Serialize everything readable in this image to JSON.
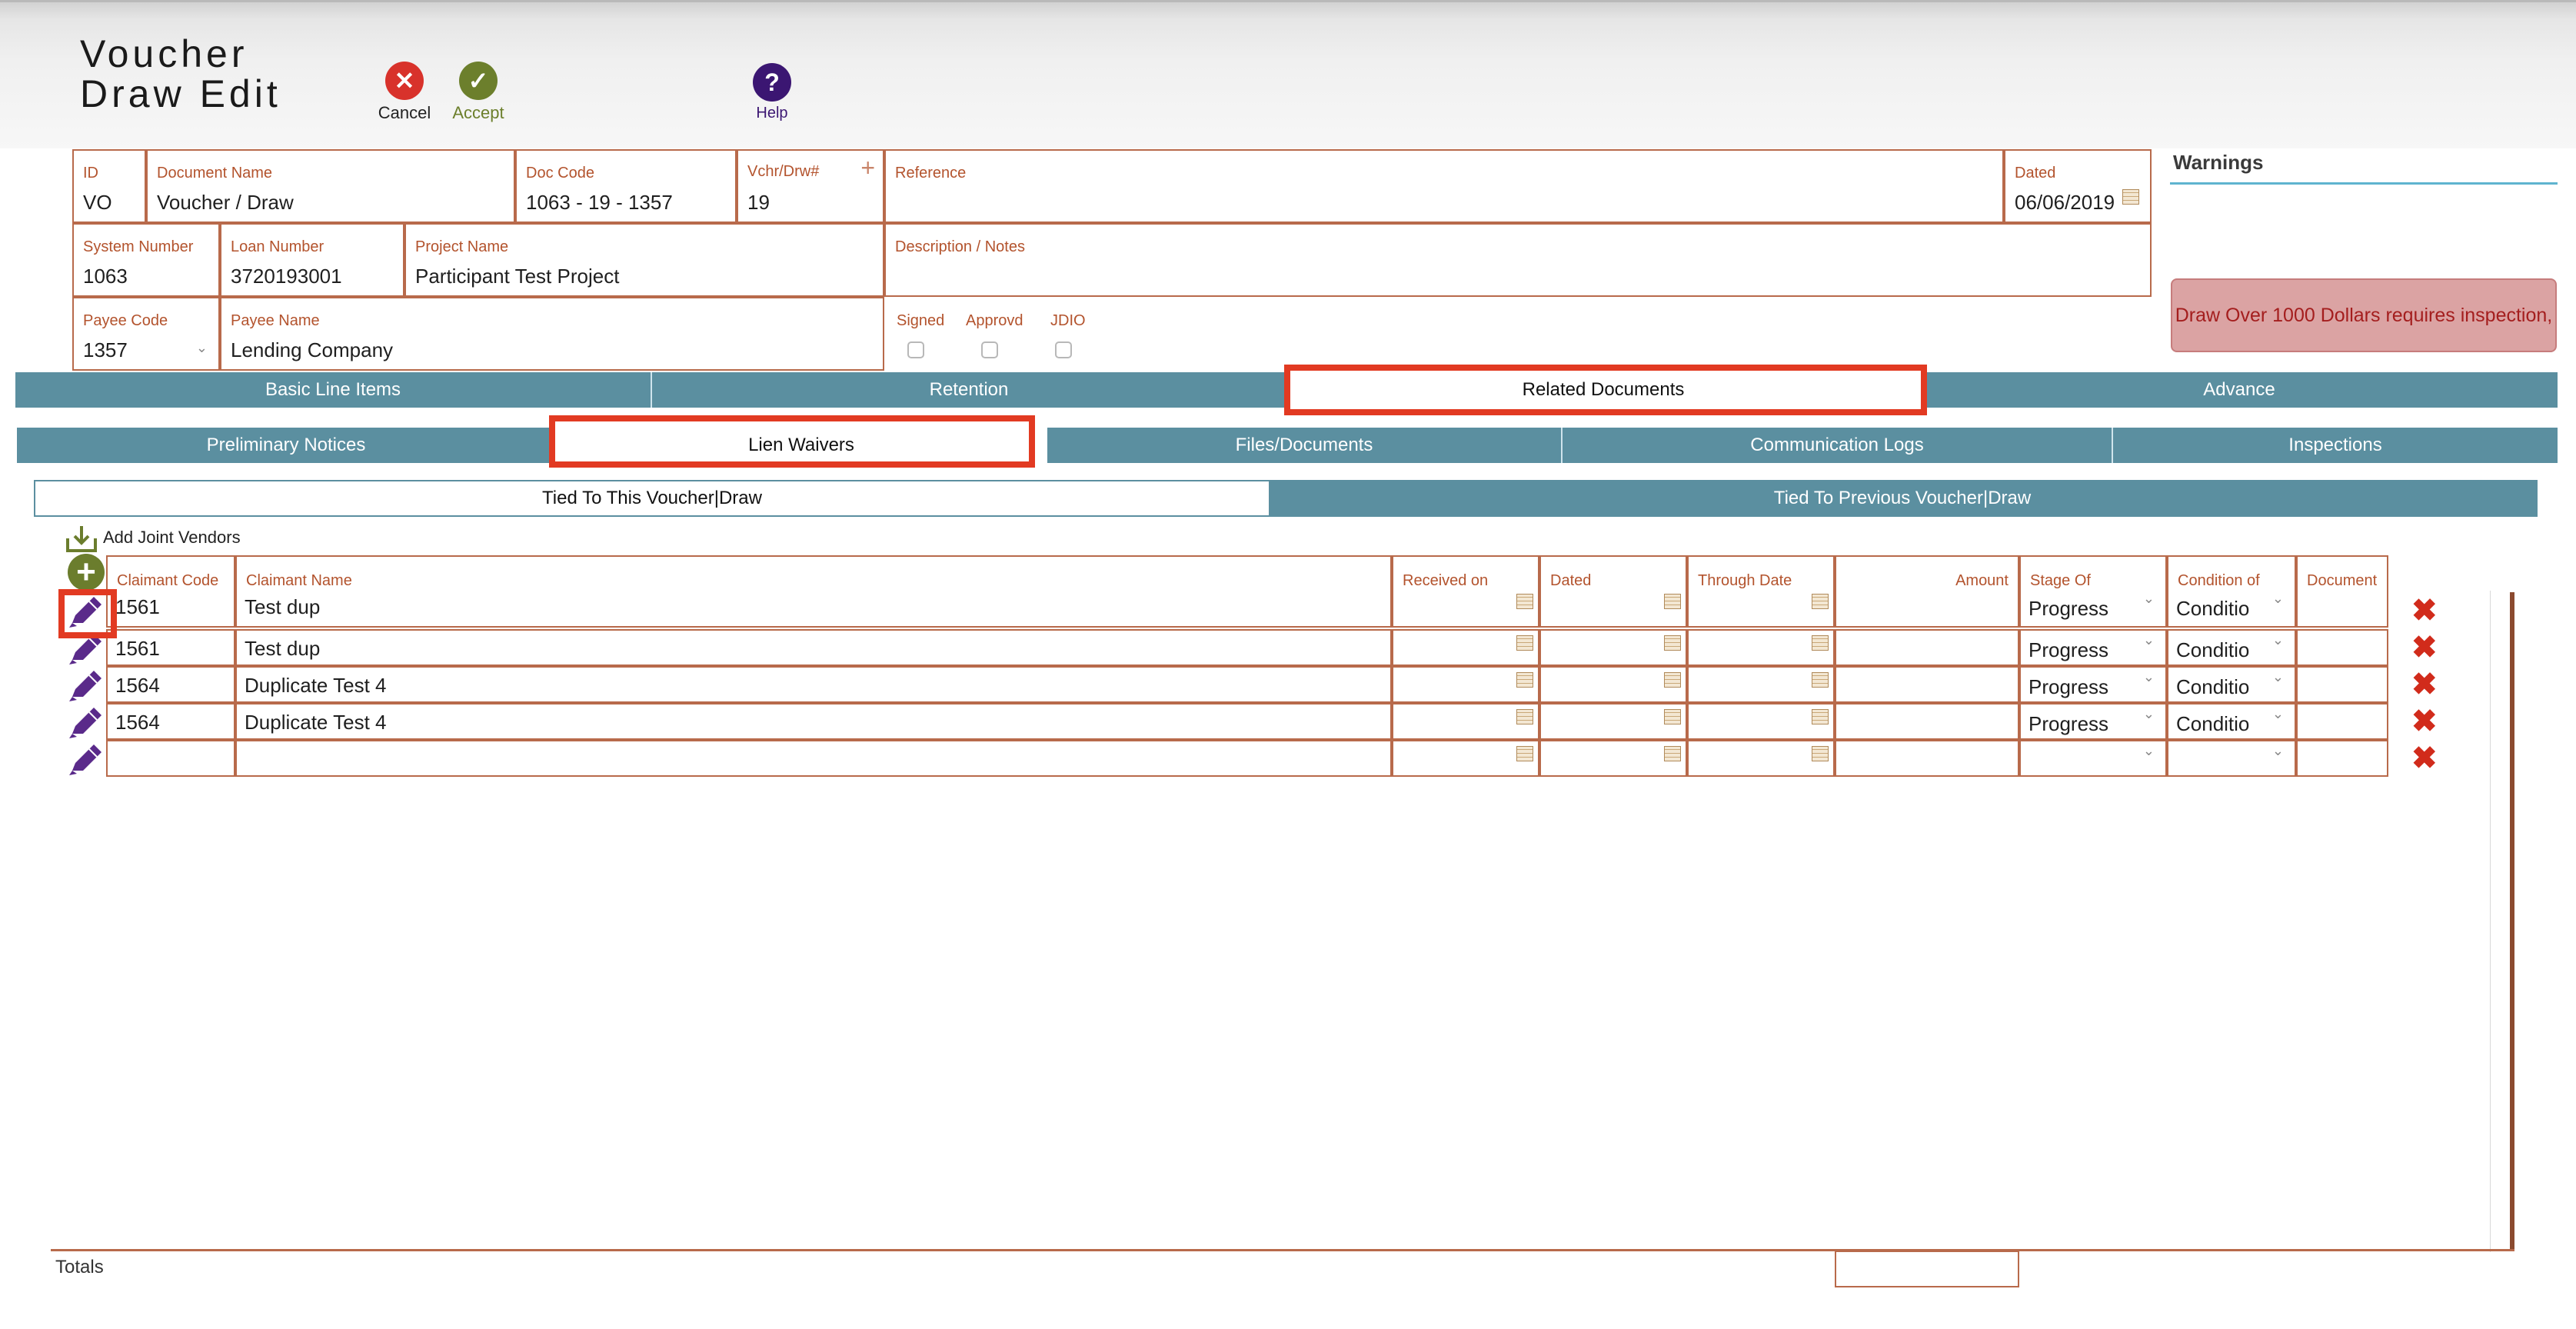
{
  "header": {
    "title_line1": "Voucher",
    "title_line2": "Draw Edit",
    "cancel_label": "Cancel",
    "accept_label": "Accept",
    "help_label": "Help"
  },
  "fields": {
    "id": {
      "label": "ID",
      "value": "VO"
    },
    "document_name": {
      "label": "Document Name",
      "value": "Voucher / Draw"
    },
    "doc_code": {
      "label": "Doc Code",
      "value": "1063 - 19 - 1357"
    },
    "vchr_drw": {
      "label": "Vchr/Drw#",
      "value": "19"
    },
    "reference": {
      "label": "Reference",
      "value": ""
    },
    "dated": {
      "label": "Dated",
      "value": "06/06/2019"
    },
    "system_number": {
      "label": "System Number",
      "value": "1063"
    },
    "loan_number": {
      "label": "Loan Number",
      "value": "3720193001"
    },
    "project_name": {
      "label": "Project Name",
      "value": "Participant Test Project"
    },
    "description": {
      "label": "Description / Notes",
      "value": ""
    },
    "payee_code": {
      "label": "Payee Code",
      "value": "1357"
    },
    "payee_name": {
      "label": "Payee Name",
      "value": "Lending Company"
    },
    "signed_label": "Signed",
    "approvd_label": "Approvd",
    "jdio_label": "JDIO"
  },
  "warnings": {
    "label": "Warnings",
    "message": "Draw Over 1000 Dollars requires inspection,"
  },
  "tabs_main": [
    "Basic Line Items",
    "Retention",
    "Related Documents",
    "Advance"
  ],
  "tabs_sub": [
    "Preliminary Notices",
    "Lien Waivers",
    "Files/Documents",
    "Communication Logs",
    "Inspections"
  ],
  "tabs_tied": [
    "Tied To This Voucher|Draw",
    "Tied To Previous Voucher|Draw"
  ],
  "grid": {
    "add_joint_label": "Add Joint Vendors",
    "headers": [
      "Claimant Code",
      "Claimant Name",
      "Received on",
      "Dated",
      "Through Date",
      "Amount",
      "Stage Of",
      "Condition of",
      "Document"
    ],
    "rows": [
      {
        "code": "1561",
        "name": "Test dup",
        "stage": "Progress",
        "condition": "Conditio"
      },
      {
        "code": "1561",
        "name": "Test dup",
        "stage": "Progress",
        "condition": "Conditio"
      },
      {
        "code": "1564",
        "name": "Duplicate Test 4",
        "stage": "Progress",
        "condition": "Conditio"
      },
      {
        "code": "1564",
        "name": "Duplicate Test 4",
        "stage": "Progress",
        "condition": "Conditio"
      },
      {
        "code": "",
        "name": "",
        "stage": "",
        "condition": ""
      }
    ],
    "totals_label": "Totals"
  },
  "colors": {
    "tab_bg": "#5b8fa0",
    "field_border": "#b86a4b",
    "label_color": "#b3532d",
    "highlight": "#e23a22",
    "cancel_red": "#d8322b",
    "accept_green": "#6c7f2c",
    "help_purple": "#3b1672",
    "pencil_purple": "#5a2a8a"
  }
}
